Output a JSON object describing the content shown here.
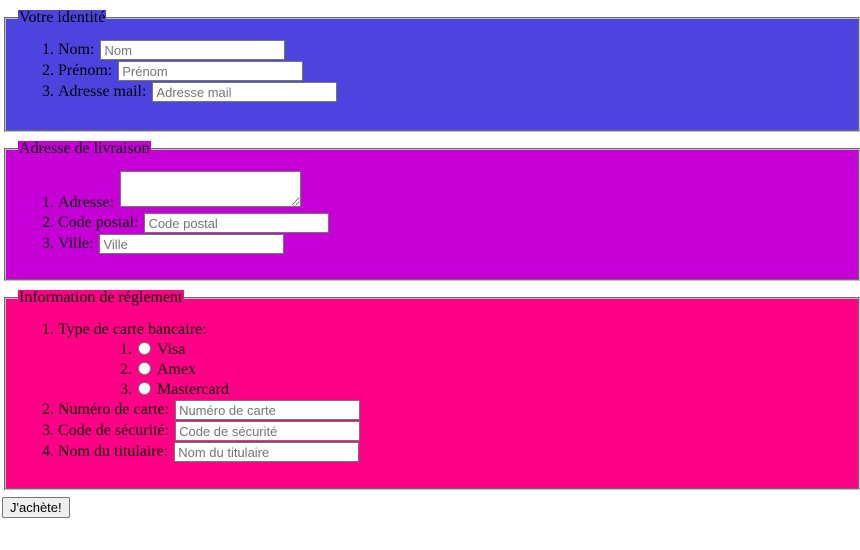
{
  "identite": {
    "legend": "Votre identité",
    "fields": [
      {
        "label": "Nom:",
        "placeholder": "Nom"
      },
      {
        "label": "Prénom:",
        "placeholder": "Prénom"
      },
      {
        "label": "Adresse mail:",
        "placeholder": "Adresse mail"
      }
    ]
  },
  "livraison": {
    "legend": "Adresse de livraison",
    "adresse_label": "Adresse:",
    "code_postal": {
      "label": "Code postal:",
      "placeholder": "Code postal"
    },
    "ville": {
      "label": "Ville:",
      "placeholder": "Ville"
    }
  },
  "reglement": {
    "legend": "Information de réglement",
    "type_carte_label": "Type de carte bancaire:",
    "cartes": [
      "Visa",
      "Amex",
      "Mastercard"
    ],
    "numero": {
      "label": "Numéro de carte:",
      "placeholder": "Numéro de carte"
    },
    "securite": {
      "label": "Code de sécurité:",
      "placeholder": "Code de sécurité"
    },
    "titulaire": {
      "label": "Nom du titulaire:",
      "placeholder": "Nom du titulaire"
    }
  },
  "submit_label": "J'achète!",
  "colors": {
    "identite_bg": "#4d44e0",
    "livraison_bg": "#c800d8",
    "reglement_bg": "#ff0087"
  }
}
